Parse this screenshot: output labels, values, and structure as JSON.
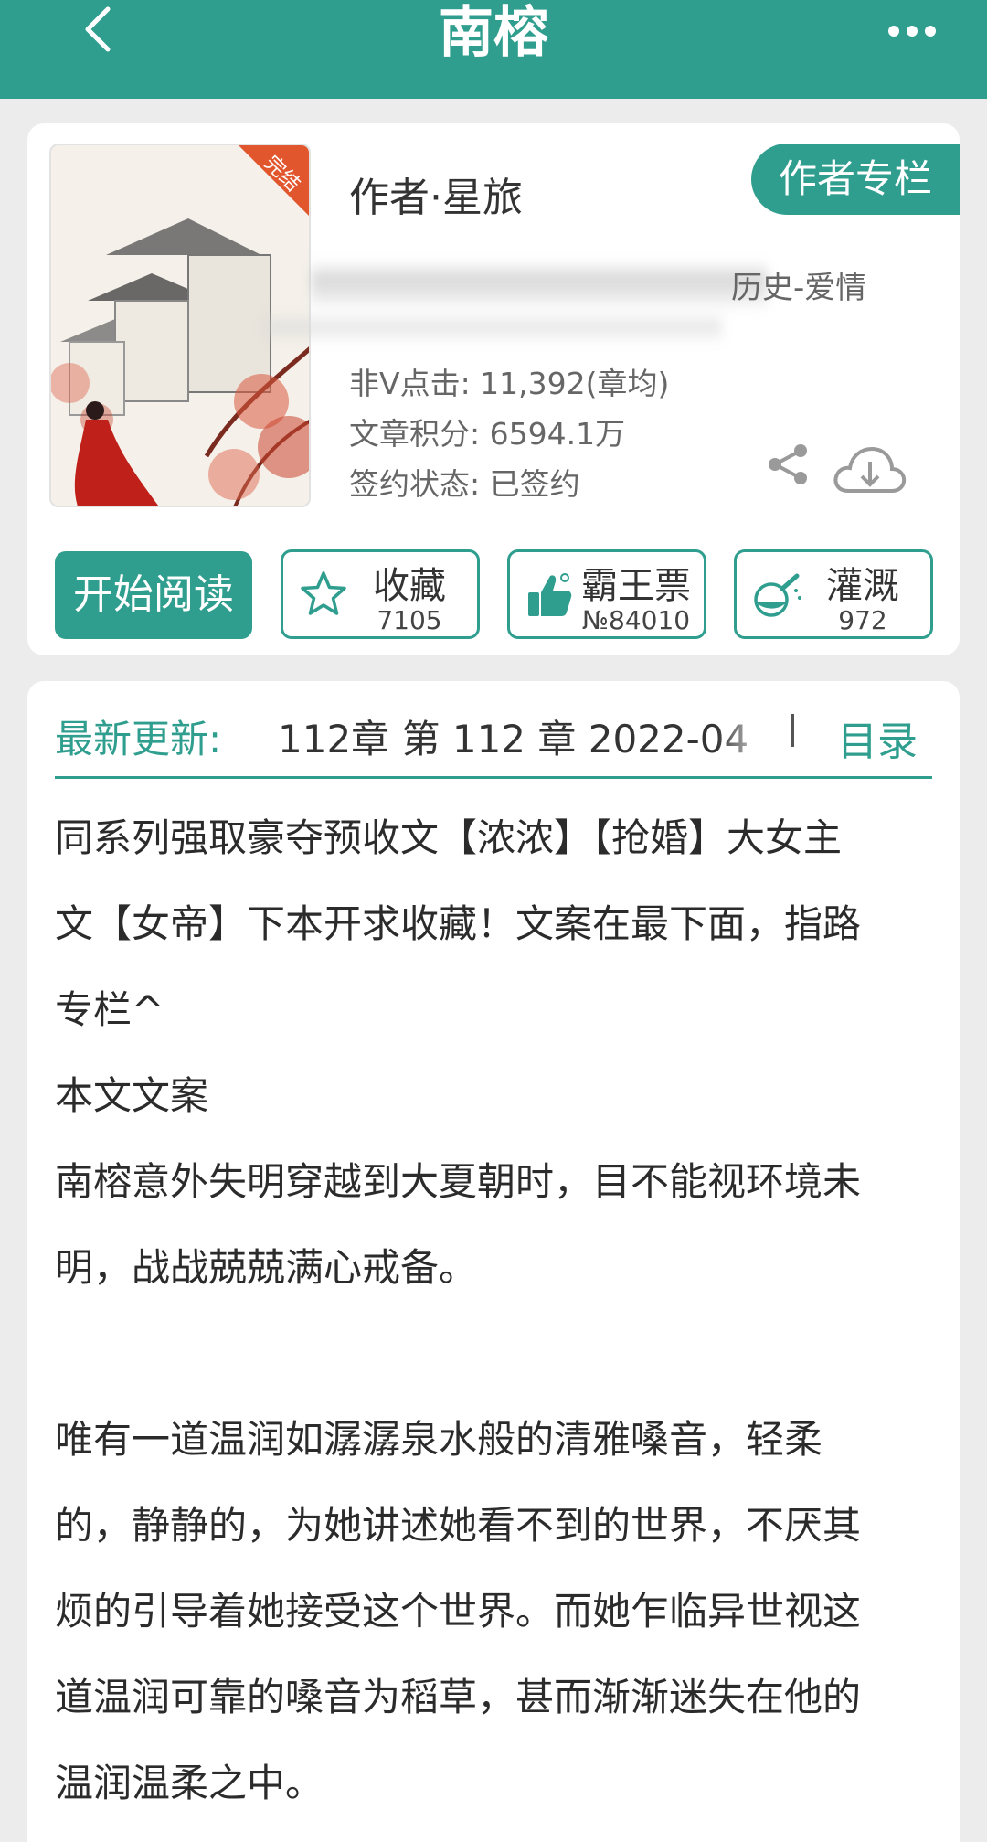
{
  "header": {
    "title": "南榕"
  },
  "book": {
    "cover_badge": "完结",
    "author": "作者·星旅",
    "author_column_label": "作者专栏",
    "genre": "历史-爱情",
    "stats": [
      "非Ⅴ点击: 11,392(章均)",
      "文章积分: 6594.1万",
      "签约状态: 已签约"
    ]
  },
  "actions": {
    "read_label": "开始阅读",
    "collect": {
      "label": "收藏",
      "count": "7105"
    },
    "vote": {
      "label": "霸王票",
      "count": "№84010"
    },
    "water": {
      "label": "灌溉",
      "count": "972"
    }
  },
  "update": {
    "label": "最新更新:",
    "text": "112章  第 112 章  2022-04",
    "toc_label": "目录"
  },
  "description": {
    "lines": [
      "同系列强取豪夺预收文【浓浓】【抢婚】大女主",
      "文【女帝】下本开求收藏！文案在最下面，指路",
      "专栏^",
      "本文文案",
      "南榕意外失明穿越到大夏朝时，目不能视环境未",
      "明，战战兢兢满心戒备。",
      "",
      "唯有一道温润如潺潺泉水般的清雅嗓音，轻柔",
      "的，静静的，为她讲述她看不到的世界，不厌其",
      "烦的引导着她接受这个世界。而她乍临异世视这",
      "道温润可靠的嗓音为稻草，甚而渐渐迷失在他的",
      "温润温柔之中。"
    ]
  },
  "colors": {
    "accent": "#2f9e8e",
    "background": "#ececec",
    "card": "#ffffff"
  }
}
